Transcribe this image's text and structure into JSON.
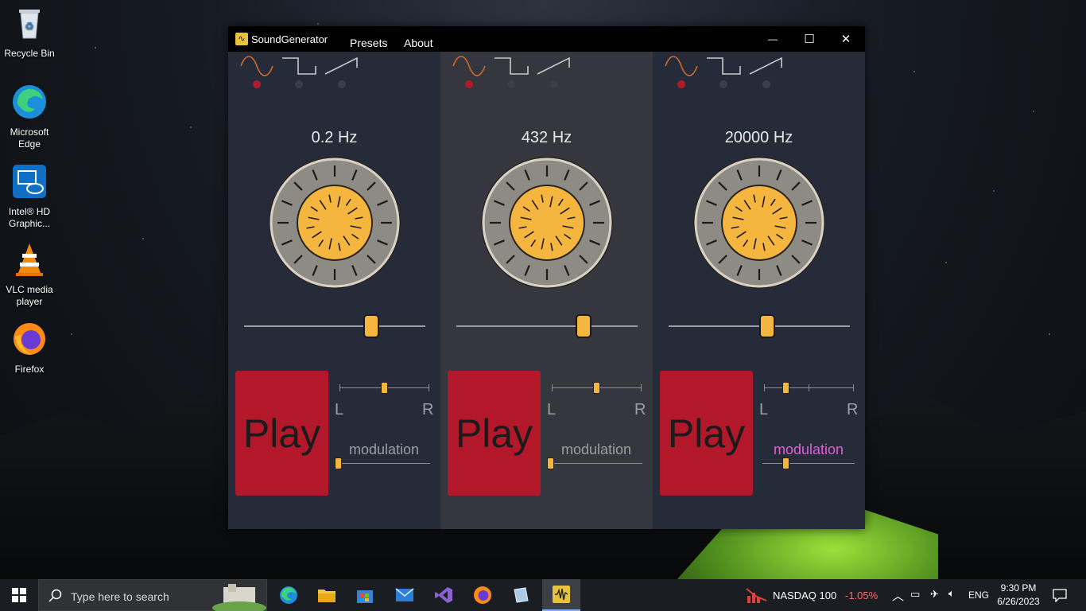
{
  "desktop": {
    "icons": [
      {
        "label": "Recycle Bin"
      },
      {
        "label": "Microsoft Edge"
      },
      {
        "label": "Intel® HD Graphic..."
      },
      {
        "label": "VLC media player"
      },
      {
        "label": "Firefox"
      }
    ]
  },
  "window": {
    "title": "SoundGenerator",
    "menu": [
      "Presets",
      "About"
    ],
    "controls": {
      "minimize": "—",
      "maximize": "☐",
      "close": "✕"
    }
  },
  "channels": [
    {
      "frequency": "0.2 Hz",
      "waveform_selected": "sine",
      "freq_slider": 0.72,
      "play_label": "Play",
      "pan_left": "L",
      "pan_right": "R",
      "pan_value": 0.5,
      "modulation_label": "modulation",
      "modulation_value": 0.0,
      "modulation_active": false
    },
    {
      "frequency": "432 Hz",
      "waveform_selected": "sine",
      "freq_slider": 0.72,
      "play_label": "Play",
      "pan_left": "L",
      "pan_right": "R",
      "pan_value": 0.5,
      "modulation_label": "modulation",
      "modulation_value": 0.0,
      "modulation_active": false
    },
    {
      "frequency": "20000 Hz",
      "waveform_selected": "sine",
      "freq_slider": 0.55,
      "play_label": "Play",
      "pan_left": "L",
      "pan_right": "R",
      "pan_value": 0.22,
      "modulation_label": "modulation",
      "modulation_value": 0.27,
      "modulation_active": true
    }
  ],
  "taskbar": {
    "search_placeholder": "Type here to search",
    "widget": {
      "name": "NASDAQ 100",
      "change": "-1.05%"
    },
    "language": "ENG",
    "time": "9:30 PM",
    "date": "6/26/2023"
  },
  "colors": {
    "accent": "#f4b63f",
    "play": "#b21829",
    "modulation_active": "#e25fd9",
    "negative": "#ff6b6b"
  }
}
